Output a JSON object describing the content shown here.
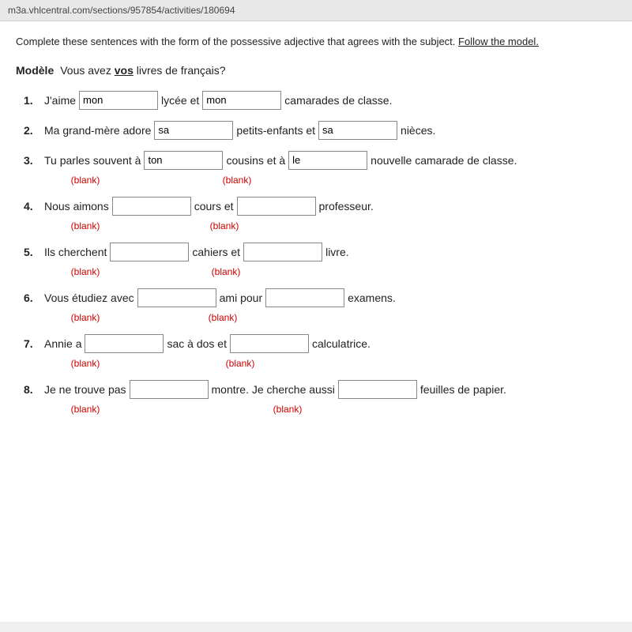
{
  "browser": {
    "url": "m3a.vhlcentral.com/sections/957854/activities/180694"
  },
  "instructions": "Complete these sentences with the form of the possessive adjective that agrees with the subject.",
  "follow_model_text": "Follow the model.",
  "modele": {
    "label": "Modèle",
    "sentence": "Vous avez ",
    "bold_word": "vos",
    "sentence_end": " livres de français?"
  },
  "exercises": [
    {
      "num": "1.",
      "parts": [
        {
          "text": "J'aime ",
          "input_value": "mon",
          "show_blank": false
        },
        {
          "text": " lycée et ",
          "input_value": "mon",
          "show_blank": false
        },
        {
          "text": " camarades de classe.",
          "input_value": null,
          "show_blank": false
        }
      ],
      "blank_labels": []
    },
    {
      "num": "2.",
      "parts": [
        {
          "text": "Ma grand-mère adore ",
          "input_value": "sa",
          "show_blank": false
        },
        {
          "text": " petits-enfants et ",
          "input_value": "sa",
          "show_blank": false
        },
        {
          "text": " nièces.",
          "input_value": null,
          "show_blank": false
        }
      ],
      "blank_labels": []
    },
    {
      "num": "3.",
      "parts": [
        {
          "text": "Tu parles souvent à ",
          "input_value": "ton",
          "show_blank": true
        },
        {
          "text": " cousins et à ",
          "input_value": "le",
          "show_blank": true
        },
        {
          "text": " nouvelle camarade de classe.",
          "input_value": null,
          "show_blank": false
        }
      ],
      "blank_labels": [
        "(blank)",
        "(blank)"
      ]
    },
    {
      "num": "4.",
      "parts": [
        {
          "text": "Nous aimons ",
          "input_value": "",
          "show_blank": true
        },
        {
          "text": " cours et ",
          "input_value": "",
          "show_blank": true
        },
        {
          "text": " professeur.",
          "input_value": null,
          "show_blank": false
        }
      ],
      "blank_labels": [
        "(blank)",
        "(blank)"
      ]
    },
    {
      "num": "5.",
      "parts": [
        {
          "text": "Ils cherchent ",
          "input_value": "",
          "show_blank": true
        },
        {
          "text": " cahiers et ",
          "input_value": "",
          "show_blank": true
        },
        {
          "text": " livre.",
          "input_value": null,
          "show_blank": false
        }
      ],
      "blank_labels": [
        "(blank)",
        "(blank)"
      ]
    },
    {
      "num": "6.",
      "parts": [
        {
          "text": "Vous étudiez avec ",
          "input_value": "",
          "show_blank": true
        },
        {
          "text": " ami pour ",
          "input_value": "",
          "show_blank": true
        },
        {
          "text": " examens.",
          "input_value": null,
          "show_blank": false
        }
      ],
      "blank_labels": [
        "(blank)",
        "(blank)"
      ]
    },
    {
      "num": "7.",
      "parts": [
        {
          "text": "Annie a ",
          "input_value": "",
          "show_blank": true
        },
        {
          "text": " sac à dos et ",
          "input_value": "",
          "show_blank": true
        },
        {
          "text": " calculatrice.",
          "input_value": null,
          "show_blank": false
        }
      ],
      "blank_labels": [
        "(blank)",
        "(blank)"
      ]
    },
    {
      "num": "8.",
      "parts": [
        {
          "text": "Je ne trouve pas ",
          "input_value": "",
          "show_blank": true
        },
        {
          "text": " montre. Je cherche aussi ",
          "input_value": "",
          "show_blank": true
        },
        {
          "text": " feuilles de papier.",
          "input_value": null,
          "show_blank": false
        }
      ],
      "blank_labels": [
        "(blank)",
        "(blank)"
      ]
    }
  ]
}
